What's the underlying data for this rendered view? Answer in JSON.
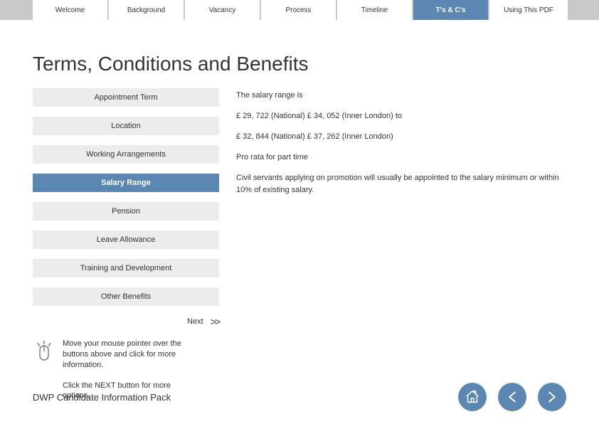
{
  "tabs": [
    {
      "label": "Welcome"
    },
    {
      "label": "Background"
    },
    {
      "label": "Vacancy"
    },
    {
      "label": "Process"
    },
    {
      "label": "Timeline"
    },
    {
      "label": "T's & C's"
    },
    {
      "label": "Using This PDF"
    }
  ],
  "title": "Terms, Conditions and Benefits",
  "sidebar": [
    {
      "label": "Appointment Term"
    },
    {
      "label": "Location"
    },
    {
      "label": "Working Arrangements"
    },
    {
      "label": "Salary Range"
    },
    {
      "label": "Pension"
    },
    {
      "label": "Leave Allowance"
    },
    {
      "label": "Training and Development"
    },
    {
      "label": "Other Benefits"
    }
  ],
  "next": {
    "label": "Next"
  },
  "hint": {
    "line1": "Move your mouse pointer over the buttons above and click for more information.",
    "line2": "Click the NEXT button for more options."
  },
  "body": {
    "p1": "The salary range is",
    "p2": "£ 29, 722 (National) £ 34, 052 (Inner London)  to",
    "p3": "£ 32, 844 (National) £ 37, 262 (Inner London)",
    "p4": "Pro rata for part time",
    "p5": "Civil servants applying on promotion will usually be appointed to the salary minimum or within 10% of existing salary."
  },
  "footer": "DWP Candidate Information Pack"
}
